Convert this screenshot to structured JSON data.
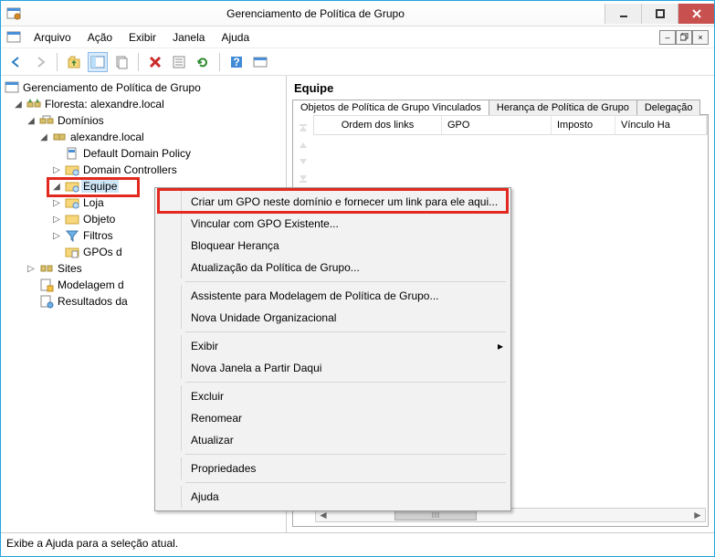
{
  "window": {
    "title": "Gerenciamento de Política de Grupo"
  },
  "menu": {
    "arquivo": "Arquivo",
    "acao": "Ação",
    "exibir": "Exibir",
    "janela": "Janela",
    "ajuda": "Ajuda"
  },
  "tree": {
    "root": "Gerenciamento de Política de Grupo",
    "forest": "Floresta: alexandre.local",
    "dominios": "Domínios",
    "domain": "alexandre.local",
    "ddp": "Default Domain Policy",
    "dc": "Domain Controllers",
    "equipe": "Equipe",
    "loja": "Loja",
    "objetos": "Objeto",
    "filtros": "Filtros",
    "gpos": "GPOs d",
    "sites": "Sites",
    "modelagem": "Modelagem d",
    "resultados": "Resultados da"
  },
  "pane": {
    "title": "Equipe",
    "tabs": {
      "linked": "Objetos de Política de Grupo Vinculados",
      "inherit": "Herança de Política de Grupo",
      "deleg": "Delegação"
    },
    "cols": {
      "ordem": "Ordem dos links",
      "gpo": "GPO",
      "imposto": "Imposto",
      "vinculo": "Vínculo Ha"
    }
  },
  "ctx": {
    "create": "Criar um GPO neste domínio e fornecer um link para ele aqui...",
    "link": "Vincular com GPO Existente...",
    "block": "Bloquear Herança",
    "update": "Atualização da Política de Grupo...",
    "assist": "Assistente para Modelagem de Política de Grupo...",
    "newou": "Nova Unidade Organizacional",
    "exibir": "Exibir",
    "novajanela": "Nova Janela a Partir Daqui",
    "excluir": "Excluir",
    "renomear": "Renomear",
    "atualizar": "Atualizar",
    "props": "Propriedades",
    "ajuda": "Ajuda"
  },
  "status": {
    "text": "Exibe a Ajuda para a seleção atual."
  }
}
